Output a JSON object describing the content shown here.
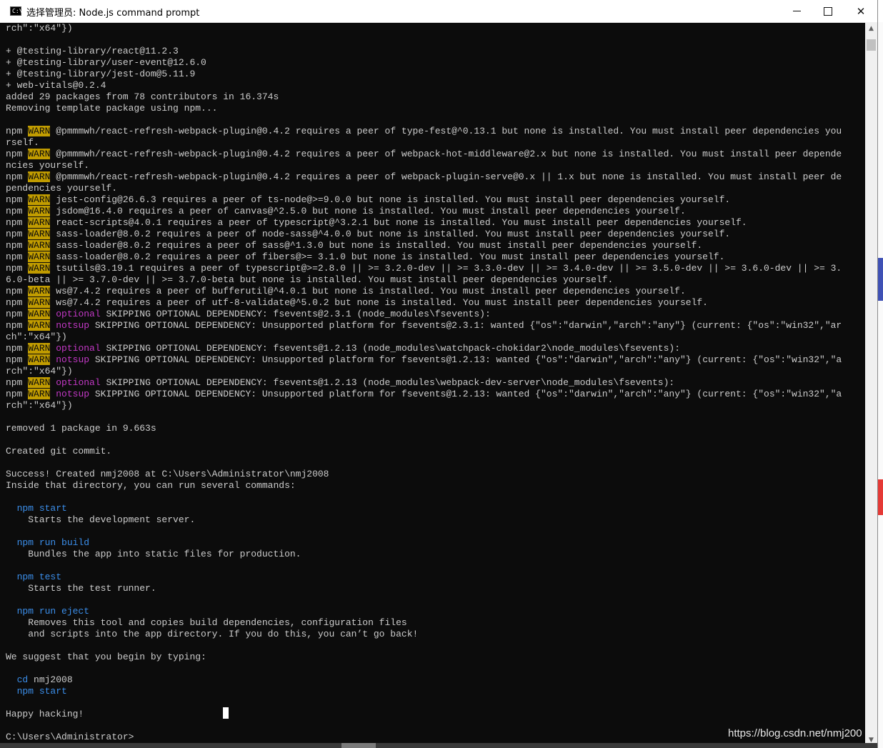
{
  "window": {
    "title": "选择管理员: Node.js command prompt",
    "icon_label": "C:\\"
  },
  "controls": {
    "minimize_icon": "minimize-icon",
    "maximize_icon": "maximize-icon",
    "close_icon": "close-icon",
    "close_glyph": "✕"
  },
  "console": {
    "lines": [
      [
        {
          "t": "rch\":\"x64\"})"
        }
      ],
      [
        {
          "t": ""
        }
      ],
      [
        {
          "t": "+ @testing-library/react@11.2.3"
        }
      ],
      [
        {
          "t": "+ @testing-library/user-event@12.6.0"
        }
      ],
      [
        {
          "t": "+ @testing-library/jest-dom@5.11.9"
        }
      ],
      [
        {
          "t": "+ web-vitals@0.2.4"
        }
      ],
      [
        {
          "t": "added 29 packages from 78 contributors in 16.374s"
        }
      ],
      [
        {
          "t": "Removing template package using npm..."
        }
      ],
      [
        {
          "t": ""
        }
      ],
      [
        {
          "t": "npm "
        },
        {
          "t": "WARN",
          "c": "warn"
        },
        {
          "t": " @pmmmwh/react-refresh-webpack-plugin@0.4.2 requires a peer of type-fest@^0.13.1 but none is installed. You must install peer dependencies you"
        }
      ],
      [
        {
          "t": "rself."
        }
      ],
      [
        {
          "t": "npm "
        },
        {
          "t": "WARN",
          "c": "warn"
        },
        {
          "t": " @pmmmwh/react-refresh-webpack-plugin@0.4.2 requires a peer of webpack-hot-middleware@2.x but none is installed. You must install peer depende"
        }
      ],
      [
        {
          "t": "ncies yourself."
        }
      ],
      [
        {
          "t": "npm "
        },
        {
          "t": "WARN",
          "c": "warn"
        },
        {
          "t": " @pmmmwh/react-refresh-webpack-plugin@0.4.2 requires a peer of webpack-plugin-serve@0.x || 1.x but none is installed. You must install peer de"
        }
      ],
      [
        {
          "t": "pendencies yourself."
        }
      ],
      [
        {
          "t": "npm "
        },
        {
          "t": "WARN",
          "c": "warn"
        },
        {
          "t": " jest-config@26.6.3 requires a peer of ts-node@>=9.0.0 but none is installed. You must install peer dependencies yourself."
        }
      ],
      [
        {
          "t": "npm "
        },
        {
          "t": "WARN",
          "c": "warn"
        },
        {
          "t": " jsdom@16.4.0 requires a peer of canvas@^2.5.0 but none is installed. You must install peer dependencies yourself."
        }
      ],
      [
        {
          "t": "npm "
        },
        {
          "t": "WARN",
          "c": "warn"
        },
        {
          "t": " react-scripts@4.0.1 requires a peer of typescript@^3.2.1 but none is installed. You must install peer dependencies yourself."
        }
      ],
      [
        {
          "t": "npm "
        },
        {
          "t": "WARN",
          "c": "warn"
        },
        {
          "t": " sass-loader@8.0.2 requires a peer of node-sass@^4.0.0 but none is installed. You must install peer dependencies yourself."
        }
      ],
      [
        {
          "t": "npm "
        },
        {
          "t": "WARN",
          "c": "warn"
        },
        {
          "t": " sass-loader@8.0.2 requires a peer of sass@^1.3.0 but none is installed. You must install peer dependencies yourself."
        }
      ],
      [
        {
          "t": "npm "
        },
        {
          "t": "WARN",
          "c": "warn"
        },
        {
          "t": " sass-loader@8.0.2 requires a peer of fibers@>= 3.1.0 but none is installed. You must install peer dependencies yourself."
        }
      ],
      [
        {
          "t": "npm "
        },
        {
          "t": "WARN",
          "c": "warn"
        },
        {
          "t": " tsutils@3.19.1 requires a peer of typescript@>=2.8.0 || >= 3.2.0-dev || >= 3.3.0-dev || >= 3.4.0-dev || >= 3.5.0-dev || >= 3.6.0-dev || >= 3."
        }
      ],
      [
        {
          "t": "6.0-beta || >= 3.7.0-dev || >= 3.7.0-beta but none is installed. You must install peer dependencies yourself."
        }
      ],
      [
        {
          "t": "npm "
        },
        {
          "t": "WARN",
          "c": "warn"
        },
        {
          "t": " ws@7.4.2 requires a peer of bufferutil@^4.0.1 but none is installed. You must install peer dependencies yourself."
        }
      ],
      [
        {
          "t": "npm "
        },
        {
          "t": "WARN",
          "c": "warn"
        },
        {
          "t": " ws@7.4.2 requires a peer of utf-8-validate@^5.0.2 but none is installed. You must install peer dependencies yourself."
        }
      ],
      [
        {
          "t": "npm "
        },
        {
          "t": "WARN",
          "c": "warn"
        },
        {
          "t": " "
        },
        {
          "t": "optional",
          "c": "optional"
        },
        {
          "t": " SKIPPING OPTIONAL DEPENDENCY: fsevents@2.3.1 (node_modules\\fsevents):"
        }
      ],
      [
        {
          "t": "npm "
        },
        {
          "t": "WARN",
          "c": "warn"
        },
        {
          "t": " "
        },
        {
          "t": "notsup",
          "c": "notsup"
        },
        {
          "t": " SKIPPING OPTIONAL DEPENDENCY: Unsupported platform for fsevents@2.3.1: wanted {\"os\":\"darwin\",\"arch\":\"any\"} (current: {\"os\":\"win32\",\"ar"
        }
      ],
      [
        {
          "t": "ch\":\"x64\"})"
        }
      ],
      [
        {
          "t": "npm "
        },
        {
          "t": "WARN",
          "c": "warn"
        },
        {
          "t": " "
        },
        {
          "t": "optional",
          "c": "optional"
        },
        {
          "t": " SKIPPING OPTIONAL DEPENDENCY: fsevents@1.2.13 (node_modules\\watchpack-chokidar2\\node_modules\\fsevents):"
        }
      ],
      [
        {
          "t": "npm "
        },
        {
          "t": "WARN",
          "c": "warn"
        },
        {
          "t": " "
        },
        {
          "t": "notsup",
          "c": "notsup"
        },
        {
          "t": " SKIPPING OPTIONAL DEPENDENCY: Unsupported platform for fsevents@1.2.13: wanted {\"os\":\"darwin\",\"arch\":\"any\"} (current: {\"os\":\"win32\",\"a"
        }
      ],
      [
        {
          "t": "rch\":\"x64\"})"
        }
      ],
      [
        {
          "t": "npm "
        },
        {
          "t": "WARN",
          "c": "warn"
        },
        {
          "t": " "
        },
        {
          "t": "optional",
          "c": "optional"
        },
        {
          "t": " SKIPPING OPTIONAL DEPENDENCY: fsevents@1.2.13 (node_modules\\webpack-dev-server\\node_modules\\fsevents):"
        }
      ],
      [
        {
          "t": "npm "
        },
        {
          "t": "WARN",
          "c": "warn"
        },
        {
          "t": " "
        },
        {
          "t": "notsup",
          "c": "notsup"
        },
        {
          "t": " SKIPPING OPTIONAL DEPENDENCY: Unsupported platform for fsevents@1.2.13: wanted {\"os\":\"darwin\",\"arch\":\"any\"} (current: {\"os\":\"win32\",\"a"
        }
      ],
      [
        {
          "t": "rch\":\"x64\"})"
        }
      ],
      [
        {
          "t": ""
        }
      ],
      [
        {
          "t": "removed 1 package in 9.663s"
        }
      ],
      [
        {
          "t": ""
        }
      ],
      [
        {
          "t": "Created git commit."
        }
      ],
      [
        {
          "t": ""
        }
      ],
      [
        {
          "t": "Success! Created nmj2008 at C:\\Users\\Administrator\\nmj2008"
        }
      ],
      [
        {
          "t": "Inside that directory, you can run several commands:"
        }
      ],
      [
        {
          "t": ""
        }
      ],
      [
        {
          "t": "  "
        },
        {
          "t": "npm start",
          "c": "cmd"
        }
      ],
      [
        {
          "t": "    Starts the development server."
        }
      ],
      [
        {
          "t": ""
        }
      ],
      [
        {
          "t": "  "
        },
        {
          "t": "npm run build",
          "c": "cmd"
        }
      ],
      [
        {
          "t": "    Bundles the app into static files for production."
        }
      ],
      [
        {
          "t": ""
        }
      ],
      [
        {
          "t": "  "
        },
        {
          "t": "npm test",
          "c": "cmd"
        }
      ],
      [
        {
          "t": "    Starts the test runner."
        }
      ],
      [
        {
          "t": ""
        }
      ],
      [
        {
          "t": "  "
        },
        {
          "t": "npm run eject",
          "c": "cmd"
        }
      ],
      [
        {
          "t": "    Removes this tool and copies build dependencies, configuration files"
        }
      ],
      [
        {
          "t": "    and scripts into the app directory. If you do this, you can’t go back!"
        }
      ],
      [
        {
          "t": ""
        }
      ],
      [
        {
          "t": "We suggest that you begin by typing:"
        }
      ],
      [
        {
          "t": ""
        }
      ],
      [
        {
          "t": "  "
        },
        {
          "t": "cd",
          "c": "cmd"
        },
        {
          "t": " nmj2008"
        }
      ],
      [
        {
          "t": "  "
        },
        {
          "t": "npm start",
          "c": "cmd"
        }
      ],
      [
        {
          "t": ""
        }
      ],
      [
        {
          "t": "Happy hacking!"
        }
      ],
      [
        {
          "t": ""
        }
      ],
      [
        {
          "t": "C:\\Users\\Administrator>"
        }
      ]
    ]
  },
  "scrollbar": {
    "up_glyph": "▲",
    "down_glyph": "▼"
  },
  "watermark": "https://blog.csdn.net/nmj200",
  "colors": {
    "background": "#0c0c0c",
    "text": "#cccccc",
    "warn_bg": "#c19c00",
    "optional": "#c238c5",
    "command": "#3b8eea"
  }
}
